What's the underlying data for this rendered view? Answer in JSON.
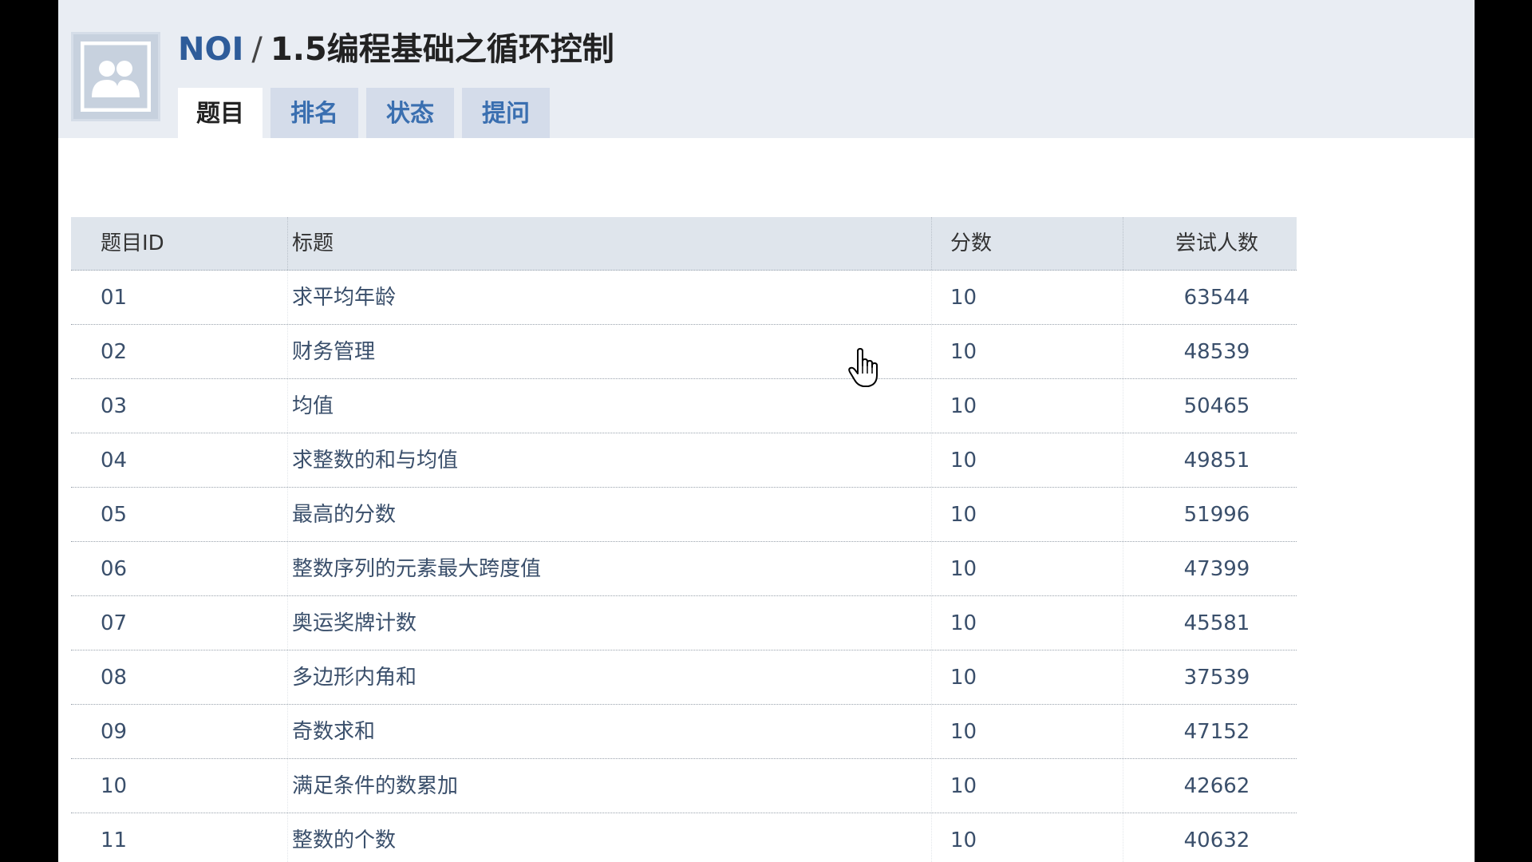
{
  "header": {
    "group_name": "NOI",
    "separator": "/",
    "contest_title": "1.5编程基础之循环控制",
    "avatar_icon": "group-avatar-icon"
  },
  "tabs": [
    {
      "label": "题目",
      "active": true
    },
    {
      "label": "排名",
      "active": false
    },
    {
      "label": "状态",
      "active": false
    },
    {
      "label": "提问",
      "active": false
    }
  ],
  "table": {
    "columns": [
      "题目ID",
      "标题",
      "分数",
      "尝试人数"
    ],
    "rows": [
      {
        "id": "01",
        "title": "求平均年龄",
        "score": "10",
        "tries": "63544"
      },
      {
        "id": "02",
        "title": "财务管理",
        "score": "10",
        "tries": "48539"
      },
      {
        "id": "03",
        "title": "均值",
        "score": "10",
        "tries": "50465"
      },
      {
        "id": "04",
        "title": "求整数的和与均值",
        "score": "10",
        "tries": "49851"
      },
      {
        "id": "05",
        "title": "最高的分数",
        "score": "10",
        "tries": "51996"
      },
      {
        "id": "06",
        "title": "整数序列的元素最大跨度值",
        "score": "10",
        "tries": "47399"
      },
      {
        "id": "07",
        "title": "奥运奖牌计数",
        "score": "10",
        "tries": "45581"
      },
      {
        "id": "08",
        "title": "多边形内角和",
        "score": "10",
        "tries": "37539"
      },
      {
        "id": "09",
        "title": "奇数求和",
        "score": "10",
        "tries": "47152"
      },
      {
        "id": "10",
        "title": "满足条件的数累加",
        "score": "10",
        "tries": "42662"
      },
      {
        "id": "11",
        "title": "整数的个数",
        "score": "10",
        "tries": "40632"
      }
    ]
  },
  "colors": {
    "header_bg": "#e9edf3",
    "tab_bg": "#d4dcea",
    "link_blue": "#3a6fb0",
    "table_head_bg": "#dfe5ec"
  }
}
